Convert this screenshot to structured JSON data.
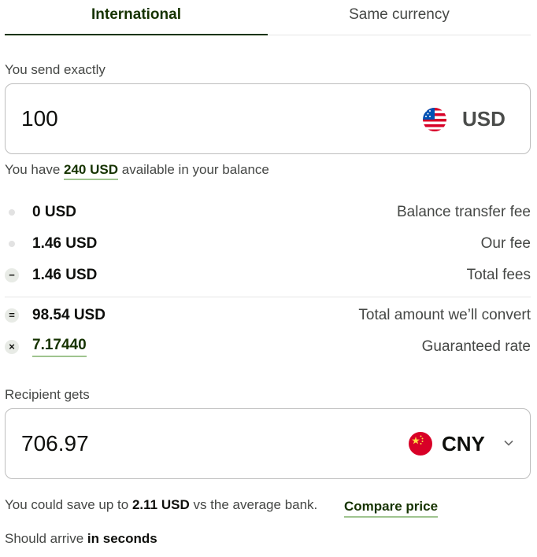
{
  "tabs": [
    {
      "label": "International",
      "active": true
    },
    {
      "label": "Same currency",
      "active": false
    }
  ],
  "send": {
    "label": "You send exactly",
    "amount": "100",
    "currency": "USD",
    "flag_icon": "us-flag-icon"
  },
  "balance": {
    "prefix": "You have",
    "amount": "240 USD",
    "suffix": "available in your balance"
  },
  "fees": [
    {
      "icon": "dot-icon",
      "value": "0 USD",
      "label": "Balance transfer fee"
    },
    {
      "icon": "dot-icon",
      "value": "1.46 USD",
      "label": "Our fee"
    },
    {
      "icon": "minus-icon",
      "value": "1.46 USD",
      "label": "Total fees"
    },
    {
      "icon": "equals-icon",
      "value": "98.54 USD",
      "label": "Total amount we’ll convert"
    },
    {
      "icon": "multiply-icon",
      "value": "7.17440",
      "label": "Guaranteed rate"
    }
  ],
  "receive": {
    "label": "Recipient gets",
    "amount": "706.97",
    "currency": "CNY",
    "flag_icon": "china-flag-icon"
  },
  "savings": {
    "prefix": "You could save up to",
    "amount": "2.11 USD",
    "suffix": "vs the average bank.",
    "compare_label": "Compare price"
  },
  "arrival": {
    "prefix": "Should arrive",
    "emphasis": "in seconds"
  },
  "colors": {
    "accent_text": "#163300",
    "link_underline": "#9fc48f",
    "border": "#bdbdbd"
  }
}
